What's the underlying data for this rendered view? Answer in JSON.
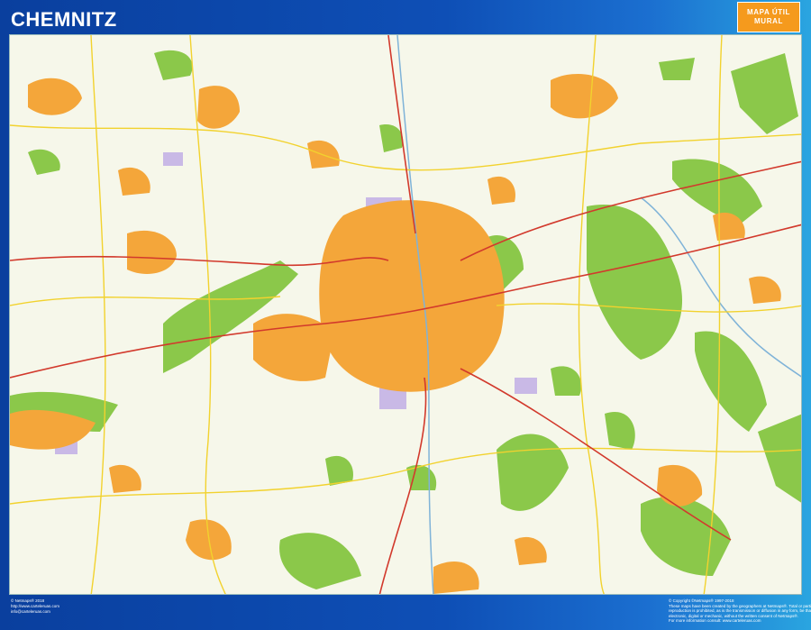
{
  "header": {
    "title": "CHEMNITZ",
    "badge_line1": "MAPA ÚTIL",
    "badge_line2": "MURAL"
  },
  "footer": {
    "left": [
      "© Netmaps® 2018",
      "http://www.carteleruas.com",
      "info@carteleruas.com"
    ],
    "right": [
      "© Copyright ©Netmaps® 1997-2018",
      "These maps have been created by the geographers at Netmaps®. Total or partial",
      "reproduction is prohibited, as is the transmission or diffusion in any form, be that",
      "electronic, digital or mechanic, without the written consent of Netmaps®.",
      "For more information consult: www.carteleruas.com"
    ]
  },
  "colors": {
    "frame": "#0d47a8",
    "badge": "#f59a1d",
    "map_background": "#f6f7ea",
    "urban": "#f4a63a",
    "forest": "#8bc84a",
    "industrial": "#c9b9e6",
    "road_major": "#d2392c",
    "road_secondary": "#f2d22e",
    "river": "#7fb3d8"
  }
}
